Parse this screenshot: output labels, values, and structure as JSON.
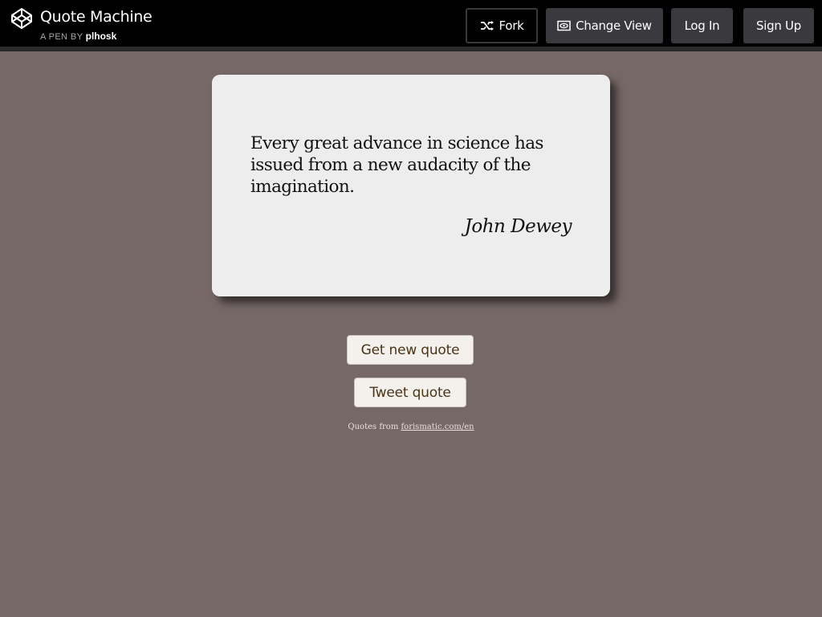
{
  "header": {
    "title": "Quote Machine",
    "byline_prefix": "A PEN BY",
    "author": "plhosk",
    "logo_icon": "codepen-logo-icon",
    "buttons": {
      "fork": "Fork",
      "change_view": "Change View",
      "login": "Log In",
      "signup": "Sign Up"
    }
  },
  "quote": {
    "text": "Every great advance in science has issued from a new audacity of the imagination.",
    "author": "John Dewey"
  },
  "actions": {
    "new_quote": "Get new quote",
    "tweet_quote": "Tweet quote"
  },
  "credit": {
    "prefix": "Quotes from",
    "link_text": "forismatic.com/en"
  },
  "colors": {
    "background": "#756867",
    "card": "#ededed",
    "topbar": "#000000",
    "button": "#3a3a3e",
    "action_text": "#4a3418"
  }
}
